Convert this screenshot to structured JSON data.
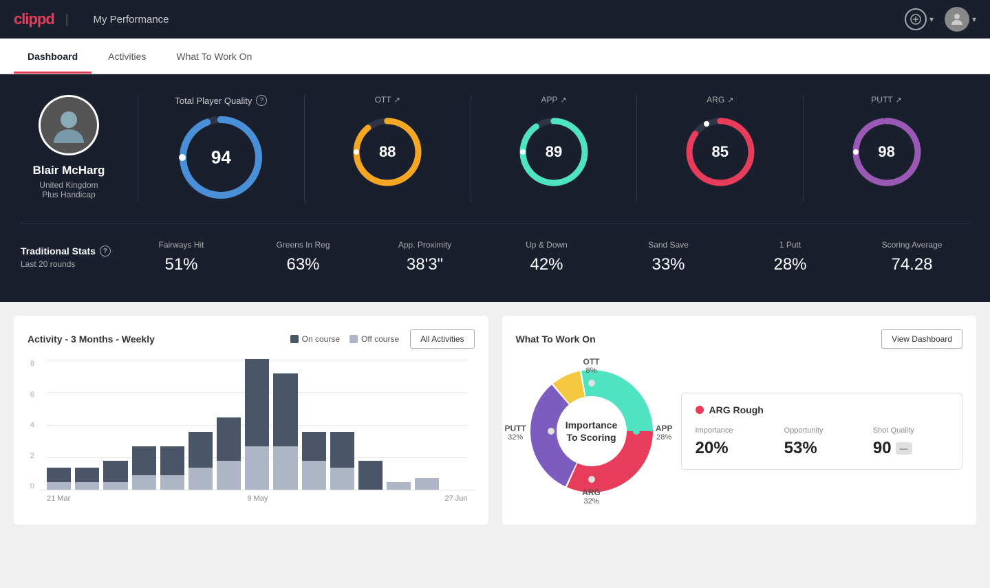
{
  "app": {
    "logo": "clippd",
    "page_title": "My Performance"
  },
  "tabs": [
    {
      "label": "Dashboard",
      "active": true
    },
    {
      "label": "Activities",
      "active": false
    },
    {
      "label": "What To Work On",
      "active": false
    }
  ],
  "player": {
    "name": "Blair McHarg",
    "country": "United Kingdom",
    "handicap": "Plus Handicap"
  },
  "quality_scores": {
    "tpq": {
      "label": "Total Player Quality",
      "value": 94,
      "color": "#4a90d9"
    },
    "ott": {
      "label": "OTT",
      "value": 88,
      "color": "#f5a623"
    },
    "app": {
      "label": "APP",
      "value": 89,
      "color": "#50e3c2"
    },
    "arg": {
      "label": "ARG",
      "value": 85,
      "color": "#e83d5a"
    },
    "putt": {
      "label": "PUTT",
      "value": 98,
      "color": "#9b59b6"
    }
  },
  "traditional_stats": {
    "label": "Traditional Stats",
    "period": "Last 20 rounds",
    "stats": [
      {
        "name": "Fairways Hit",
        "value": "51%"
      },
      {
        "name": "Greens In Reg",
        "value": "63%"
      },
      {
        "name": "App. Proximity",
        "value": "38'3\""
      },
      {
        "name": "Up & Down",
        "value": "42%"
      },
      {
        "name": "Sand Save",
        "value": "33%"
      },
      {
        "name": "1 Putt",
        "value": "28%"
      },
      {
        "name": "Scoring Average",
        "value": "74.28"
      }
    ]
  },
  "activity_chart": {
    "title": "Activity - 3 Months - Weekly",
    "legend": {
      "on_course": "On course",
      "off_course": "Off course"
    },
    "button": "All Activities",
    "x_labels": [
      "21 Mar",
      "9 May",
      "27 Jun"
    ],
    "y_labels": [
      "8",
      "6",
      "4",
      "2",
      "0"
    ],
    "bars": [
      {
        "on": 1,
        "off": 0.5
      },
      {
        "on": 1,
        "off": 0.5
      },
      {
        "on": 1.5,
        "off": 0.5
      },
      {
        "on": 2,
        "off": 1
      },
      {
        "on": 2,
        "off": 1
      },
      {
        "on": 2.5,
        "off": 1.5
      },
      {
        "on": 3,
        "off": 2
      },
      {
        "on": 6,
        "off": 3
      },
      {
        "on": 5,
        "off": 3
      },
      {
        "on": 2,
        "off": 2
      },
      {
        "on": 2.5,
        "off": 1.5
      },
      {
        "on": 2,
        "off": 0
      },
      {
        "on": 0,
        "off": 0.5
      },
      {
        "on": 0,
        "off": 0.8
      },
      {
        "on": 0,
        "off": 0
      }
    ]
  },
  "what_to_work_on": {
    "title": "What To Work On",
    "button": "View Dashboard",
    "donut_center": "Importance\nTo Scoring",
    "segments": [
      {
        "label": "OTT",
        "value": "8%",
        "color": "#f5c842"
      },
      {
        "label": "APP",
        "value": "28%",
        "color": "#50e3c2"
      },
      {
        "label": "ARG",
        "value": "32%",
        "color": "#e83d5a"
      },
      {
        "label": "PUTT",
        "value": "32%",
        "color": "#7c5cbf"
      }
    ],
    "info_card": {
      "title": "ARG Rough",
      "dot_color": "#e83d5a",
      "metrics": [
        {
          "label": "Importance",
          "value": "20%"
        },
        {
          "label": "Opportunity",
          "value": "53%"
        },
        {
          "label": "Shot Quality",
          "value": "90",
          "badge": ""
        }
      ]
    }
  }
}
